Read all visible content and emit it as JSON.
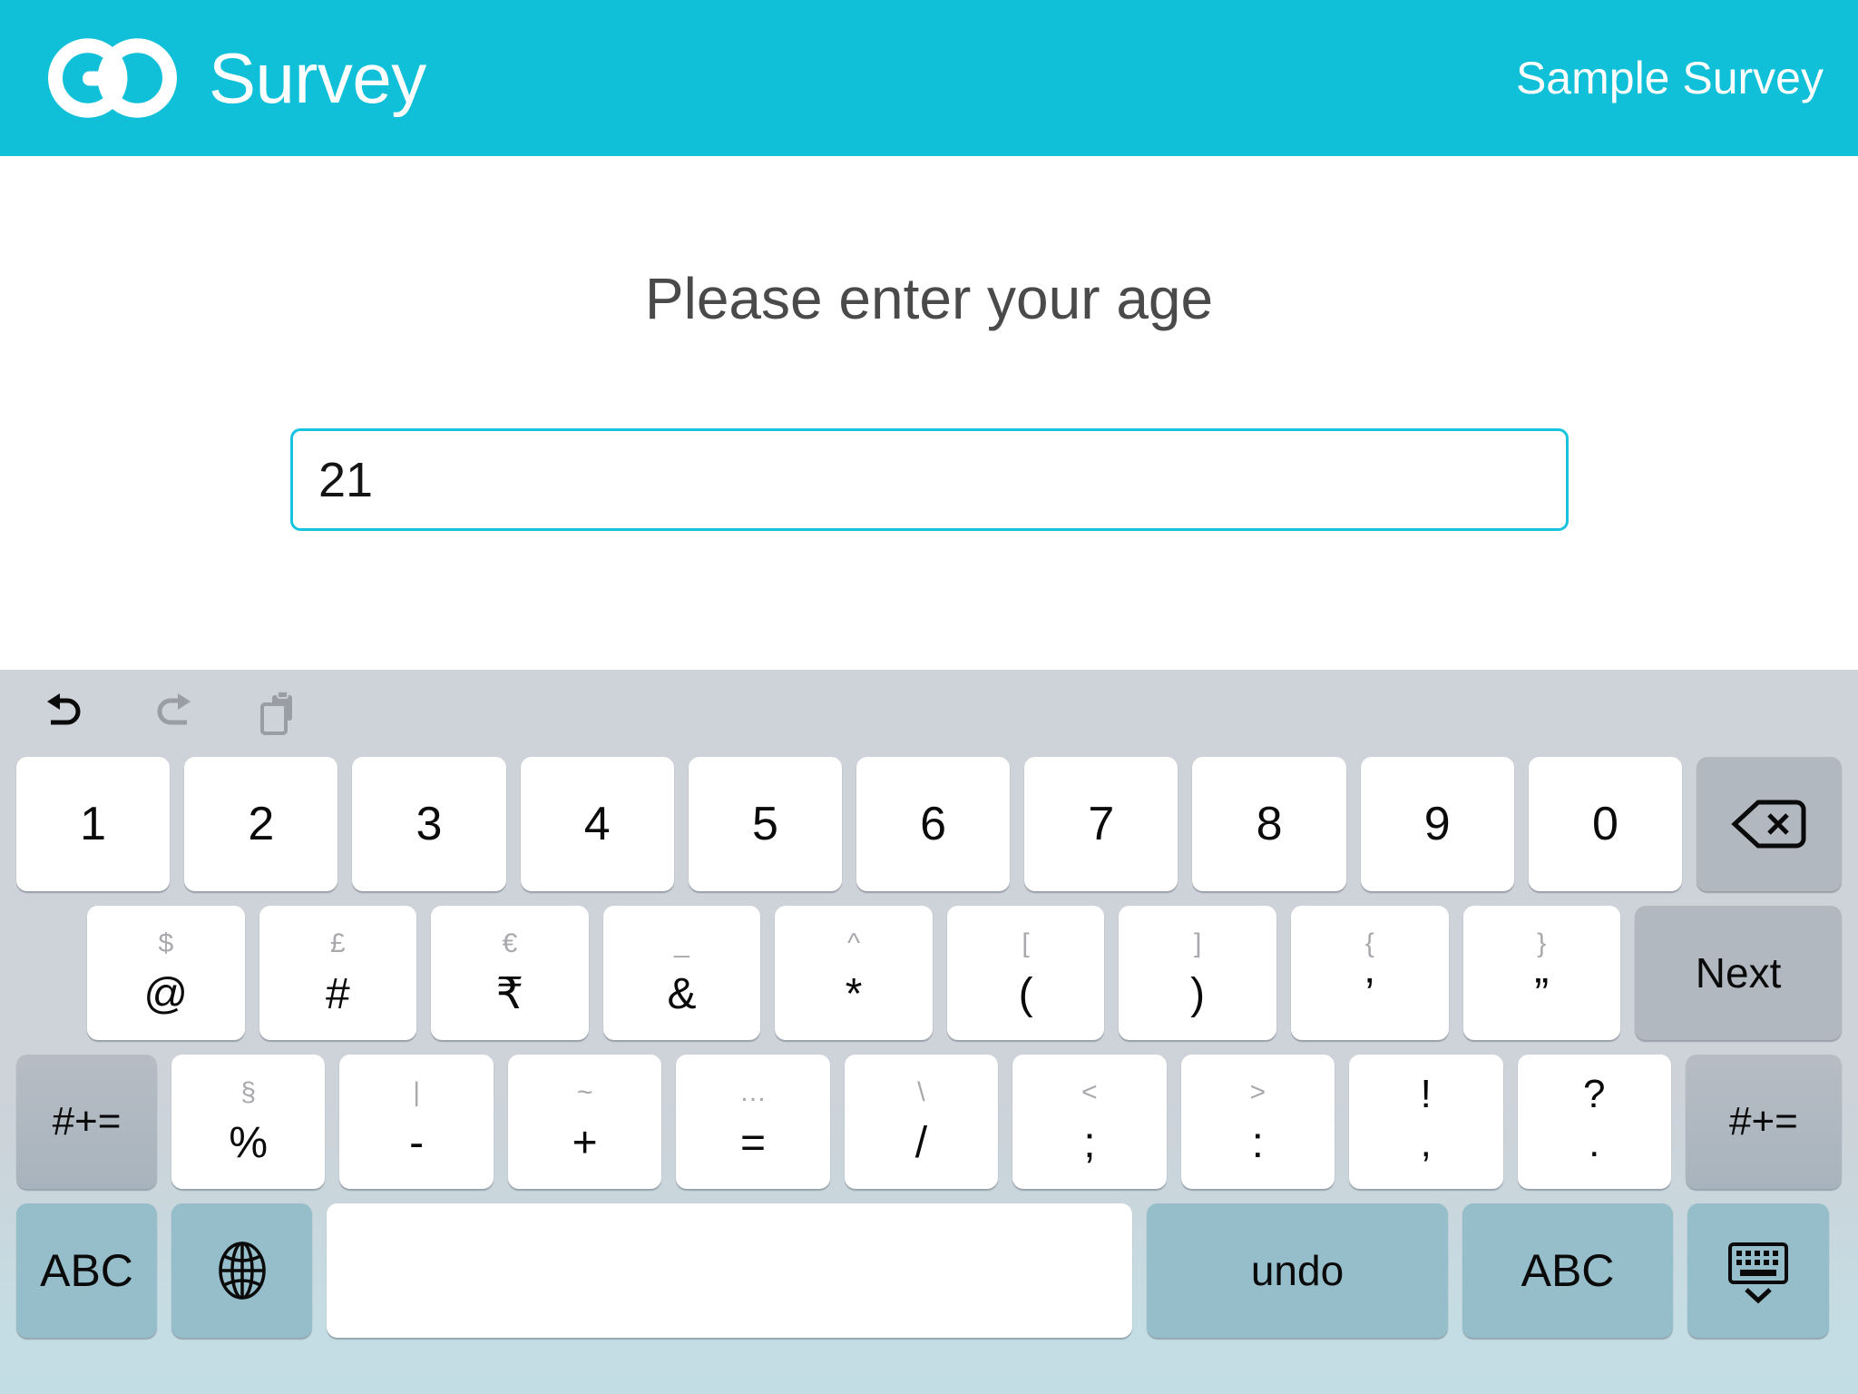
{
  "header": {
    "logo_icon": "go-logo-icon",
    "brand": "Survey",
    "survey_name": "Sample Survey",
    "background_color": "#0fc0d8"
  },
  "content": {
    "question": "Please enter your age",
    "answer": {
      "value": "21",
      "placeholder": "",
      "border_color": "#17c3dd"
    }
  },
  "keyboard": {
    "toolbar": [
      {
        "name": "undo-icon",
        "state": "enabled"
      },
      {
        "name": "redo-icon",
        "state": "disabled"
      },
      {
        "name": "paste-icon",
        "state": "disabled"
      }
    ],
    "row1": [
      {
        "main": "1"
      },
      {
        "main": "2"
      },
      {
        "main": "3"
      },
      {
        "main": "4"
      },
      {
        "main": "5"
      },
      {
        "main": "6"
      },
      {
        "main": "7"
      },
      {
        "main": "8"
      },
      {
        "main": "9"
      },
      {
        "main": "0"
      }
    ],
    "row1_backspace": {
      "icon": "backspace-icon"
    },
    "row2": [
      {
        "sub": "$",
        "main": "@"
      },
      {
        "sub": "£",
        "main": "#"
      },
      {
        "sub": "€",
        "main": "₹"
      },
      {
        "sub": "_",
        "main": "&"
      },
      {
        "sub": "^",
        "main": "*"
      },
      {
        "sub": "[",
        "main": "("
      },
      {
        "sub": "]",
        "main": ")"
      },
      {
        "sub": "{",
        "main": "’"
      },
      {
        "sub": "}",
        "main": "”"
      }
    ],
    "row2_next": {
      "label": "Next"
    },
    "row3_shift_left": {
      "label": "#+="
    },
    "row3": [
      {
        "sub": "§",
        "main": "%"
      },
      {
        "sub": "|",
        "main": "-"
      },
      {
        "sub": "~",
        "main": "+"
      },
      {
        "sub": "…",
        "main": "="
      },
      {
        "sub": "\\",
        "main": "/"
      },
      {
        "sub": "<",
        "main": ";"
      },
      {
        "sub": ">",
        "main": ":"
      },
      {
        "sub": "!",
        "main": ",",
        "both_dark": true
      },
      {
        "sub": "?",
        "main": ".",
        "both_dark": true
      }
    ],
    "row3_shift_right": {
      "label": "#+="
    },
    "row4": {
      "abc_left": {
        "label": "ABC"
      },
      "globe": {
        "icon": "globe-icon"
      },
      "space": {
        "label": ""
      },
      "undo": {
        "label": "undo"
      },
      "abc_right": {
        "label": "ABC"
      },
      "dismiss": {
        "icon": "dismiss-keyboard-icon"
      }
    }
  }
}
